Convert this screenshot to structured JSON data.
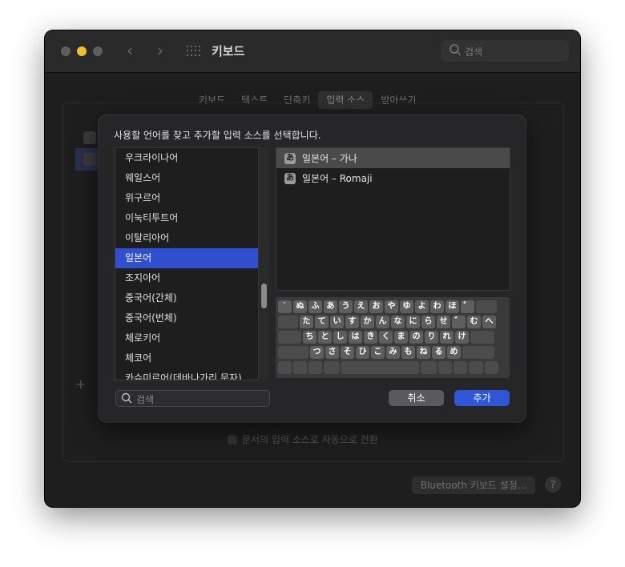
{
  "window": {
    "title": "키보드",
    "search_placeholder": "검색"
  },
  "tabs": [
    "키보드",
    "텍스트",
    "단축키",
    "입력 소스",
    "받아쓰기"
  ],
  "behind": {
    "auto_switch_label": "문서의 입력 소스로 자동으로 전환",
    "bluetooth_button": "Bluetooth 키보드 설정...",
    "help": "?"
  },
  "sheet": {
    "title": "사용할 언어를 찾고 추가할 입력 소스를 선택합니다.",
    "languages": [
      "우크라이나어",
      "웨일스어",
      "위구르어",
      "이눅티투트어",
      "이탈리아어",
      "일본어",
      "조지아어",
      "중국어(간체)",
      "중국어(번체)",
      "체로키어",
      "체코어",
      "카슈미르어(데바나가리 문자)"
    ],
    "selected_language_index": 5,
    "sources": [
      {
        "icon": "あ",
        "label": "일본어 – 가나"
      },
      {
        "icon": "あ",
        "label": "일본어 – Romaji"
      }
    ],
    "keyboard_rows": [
      [
        "`",
        "ぬ",
        "ふ",
        "あ",
        "う",
        "え",
        "お",
        "や",
        "ゆ",
        "よ",
        "わ",
        "ほ",
        "゜",
        ""
      ],
      [
        "",
        "た",
        "て",
        "い",
        "す",
        "か",
        "ん",
        "な",
        "に",
        "ら",
        "せ",
        "゛",
        "む",
        "へ"
      ],
      [
        "",
        "ち",
        "と",
        "し",
        "は",
        "き",
        "く",
        "ま",
        "の",
        "り",
        "れ",
        "け",
        ""
      ],
      [
        "",
        "つ",
        "さ",
        "そ",
        "ひ",
        "こ",
        "み",
        "も",
        "ね",
        "る",
        "め",
        ""
      ]
    ],
    "search_placeholder": "검색",
    "cancel_label": "취소",
    "add_label": "추가"
  }
}
